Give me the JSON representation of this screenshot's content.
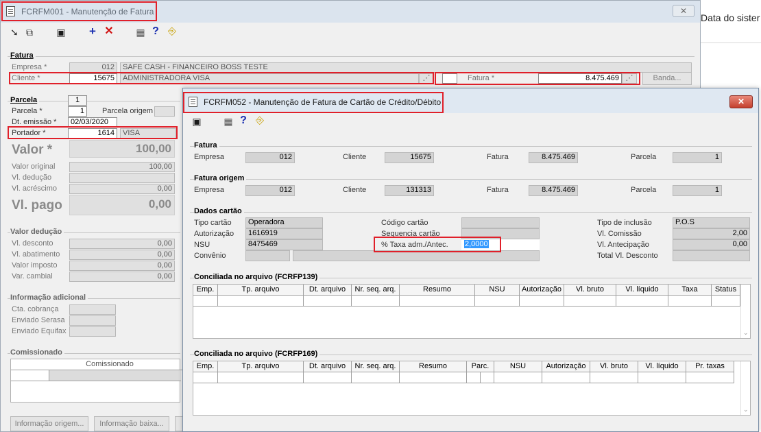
{
  "background": {
    "partial_text": "Data do sister"
  },
  "win1": {
    "title": "FCRFM001 - Manutenção de Fatura",
    "close": "✕",
    "fatura": {
      "section": "Fatura",
      "empresa_label": "Empresa *",
      "empresa_code": "012",
      "empresa_name": "SAFE CASH - FINANCEIRO BOSS TESTE",
      "cliente_label": "Cliente *",
      "cliente_code": "15675",
      "cliente_name": "ADMINISTRADORA VISA",
      "fatura_label": "Fatura *",
      "fatura_value": "8.475.469",
      "banda_button": "Banda..."
    },
    "parcela": {
      "section": "Parcela",
      "tab": "1",
      "parcela_label": "Parcela *",
      "parcela_value": "1",
      "parcela_origem_label": "Parcela origem",
      "dt_emissao_label": "Dt. emissão *",
      "dt_emissao_value": "02/03/2020",
      "portador_label": "Portador *",
      "portador_code": "1614",
      "portador_name": "VISA",
      "valor_label": "Valor *",
      "valor_value": "100,00",
      "valor_original_label": "Valor original",
      "valor_original_value": "100,00",
      "vl_deducao_label": "Vl. dedução",
      "vl_acrescimo_label": "Vl. acréscimo",
      "vl_acrescimo_value": "0,00",
      "vl_pago_label": "Vl. pago",
      "vl_pago_value": "0,00"
    },
    "valor_deducao": {
      "section": "Valor dedução",
      "vl_desconto_label": "Vl. desconto",
      "vl_desconto_value": "0,00",
      "vl_abatimento_label": "Vl. abatimento",
      "vl_abatimento_value": "0,00",
      "valor_imposto_label": "Valor imposto",
      "valor_imposto_value": "0,00",
      "var_cambial_label": "Var. cambial",
      "var_cambial_value": "0,00"
    },
    "info_adicional": {
      "section": "Informação adicional",
      "cta_cobranca_label": "Cta. cobrança",
      "enviado_serasa_label": "Enviado Serasa",
      "enviado_equifax_label": "Enviado Equifax"
    },
    "comissionado": {
      "section": "Comissionado",
      "column": "Comissionado"
    },
    "buttons": {
      "info_origem": "Informação origem...",
      "info_baixa": "Informação baixa..."
    }
  },
  "win2": {
    "title": "FCRFM052 - Manutenção de Fatura de Cartão de Crédito/Débito",
    "close": "✕",
    "fatura": {
      "section": "Fatura",
      "empresa_label": "Empresa",
      "empresa_value": "012",
      "cliente_label": "Cliente",
      "cliente_value": "15675",
      "fatura_label": "Fatura",
      "fatura_value": "8.475.469",
      "parcela_label": "Parcela",
      "parcela_value": "1"
    },
    "fatura_origem": {
      "section": "Fatura origem",
      "empresa_label": "Empresa",
      "empresa_value": "012",
      "cliente_label": "Cliente",
      "cliente_value": "131313",
      "fatura_label": "Fatura",
      "fatura_value": "8.475.469",
      "parcela_label": "Parcela",
      "parcela_value": "1"
    },
    "dados_cartao": {
      "section": "Dados cartão",
      "tipo_cartao_label": "Tipo cartão",
      "tipo_cartao_value": "Operadora",
      "autorizacao_label": "Autorização",
      "autorizacao_value": "1616919",
      "nsu_label": "NSU",
      "nsu_value": "8475469",
      "convenio_label": "Convênio",
      "codigo_cartao_label": "Código cartão",
      "sequencia_cartao_label": "Sequencia cartão",
      "taxa_label": "% Taxa adm./Antec.",
      "taxa_value": "2,0000",
      "tipo_inclusao_label": "Tipo de inclusão",
      "tipo_inclusao_value": "P.O.S",
      "vl_comissao_label": "Vl. Comissão",
      "vl_comissao_value": "2,00",
      "vl_antecipacao_label": "Vl. Antecipação",
      "vl_antecipacao_value": "0,00",
      "total_vl_desconto_label": "Total Vl. Desconto"
    },
    "conc139": {
      "section": "Conciliada no arquivo (FCRFP139)",
      "columns": [
        "Emp.",
        "Tp. arquivo",
        "Dt. arquivo",
        "Nr. seq. arq.",
        "Resumo",
        "NSU",
        "Autorização",
        "Vl. bruto",
        "Vl. líquido",
        "Taxa",
        "Status"
      ]
    },
    "conc169": {
      "section": "Conciliada no arquivo (FCRFP169)",
      "columns": [
        "Emp.",
        "Tp. arquivo",
        "Dt. arquivo",
        "Nr. seq. arq.",
        "Resumo",
        "Parc.",
        "NSU",
        "Autorização",
        "Vl. bruto",
        "Vl. líquido",
        "Pr. taxas"
      ]
    }
  },
  "colors": {
    "highlight": "#e0202a",
    "selection": "#3399ff"
  }
}
